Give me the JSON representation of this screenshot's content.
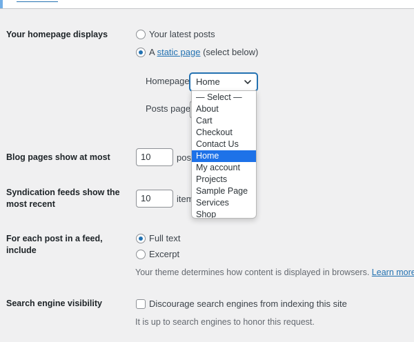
{
  "homepage": {
    "label": "Your homepage displays",
    "latest_label": "Your latest posts",
    "static_prefix": "A",
    "static_link": "static page",
    "static_suffix": "(select below)",
    "homepage_label": "Homepage:",
    "homepage_value": "Home",
    "posts_page_label": "Posts page:",
    "options": [
      "— Select —",
      "About",
      "Cart",
      "Checkout",
      "Contact Us",
      "Home",
      "My account",
      "Projects",
      "Sample Page",
      "Services",
      "Shop"
    ],
    "selected_index": 5
  },
  "blog_pages": {
    "label": "Blog pages show at most",
    "value": "10",
    "unit_partial": "pos"
  },
  "syndication": {
    "label_line1": "Syndication feeds show the",
    "label_line2": "most recent",
    "value": "10",
    "unit_partial": "item"
  },
  "feed": {
    "label": "For each post in a feed, include",
    "full_text": "Full text",
    "excerpt": "Excerpt",
    "help_text": "Your theme determines how content is displayed in browsers.",
    "learn_more": "Learn more abo"
  },
  "search": {
    "label": "Search engine visibility",
    "checkbox_label": "Discourage search engines from indexing this site",
    "help_text": "It is up to search engines to honor this request."
  },
  "colors": {
    "accent": "#2271b1",
    "selected_option_bg": "#1e72e8",
    "background": "#f0f0f1"
  }
}
